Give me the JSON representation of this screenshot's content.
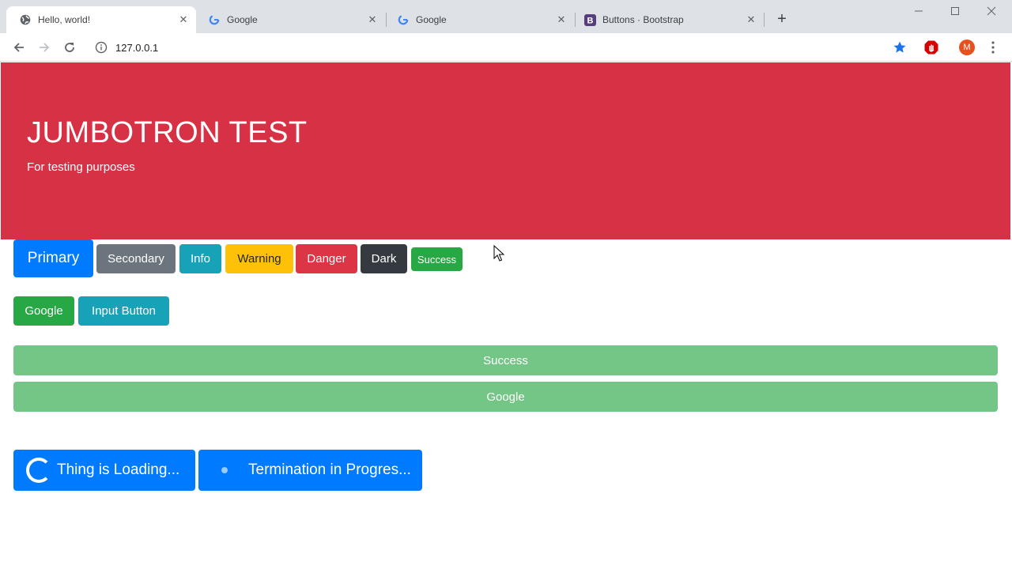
{
  "browser": {
    "tabs": [
      {
        "title": "Hello, world!",
        "icon": "globe-icon",
        "active": true
      },
      {
        "title": "Google",
        "icon": "google-icon",
        "active": false
      },
      {
        "title": "Google",
        "icon": "google-icon",
        "active": false
      },
      {
        "title": "Buttons · Bootstrap",
        "icon": "bootstrap-icon",
        "active": false
      }
    ],
    "address": "127.0.0.1",
    "profile_initial": "M"
  },
  "jumbotron": {
    "title": "JUMBOTRON TEST",
    "subtitle": "For testing purposes"
  },
  "buttons": {
    "primary": "Primary",
    "secondary": "Secondary",
    "info": "Info",
    "warning": "Warning",
    "danger": "Danger",
    "dark": "Dark",
    "success_small": "Success",
    "google": "Google",
    "input": "Input Button",
    "block_success": "Success",
    "block_google": "Google",
    "loading": "Thing is Loading...",
    "terminating": "Termination in Progres..."
  },
  "colors": {
    "primary": "#007bff",
    "secondary": "#6c757d",
    "info": "#17a2b8",
    "warning": "#ffc107",
    "danger": "#dc3545",
    "dark": "#343a40",
    "success": "#28a745",
    "jumbotron_bg": "#d63145"
  }
}
